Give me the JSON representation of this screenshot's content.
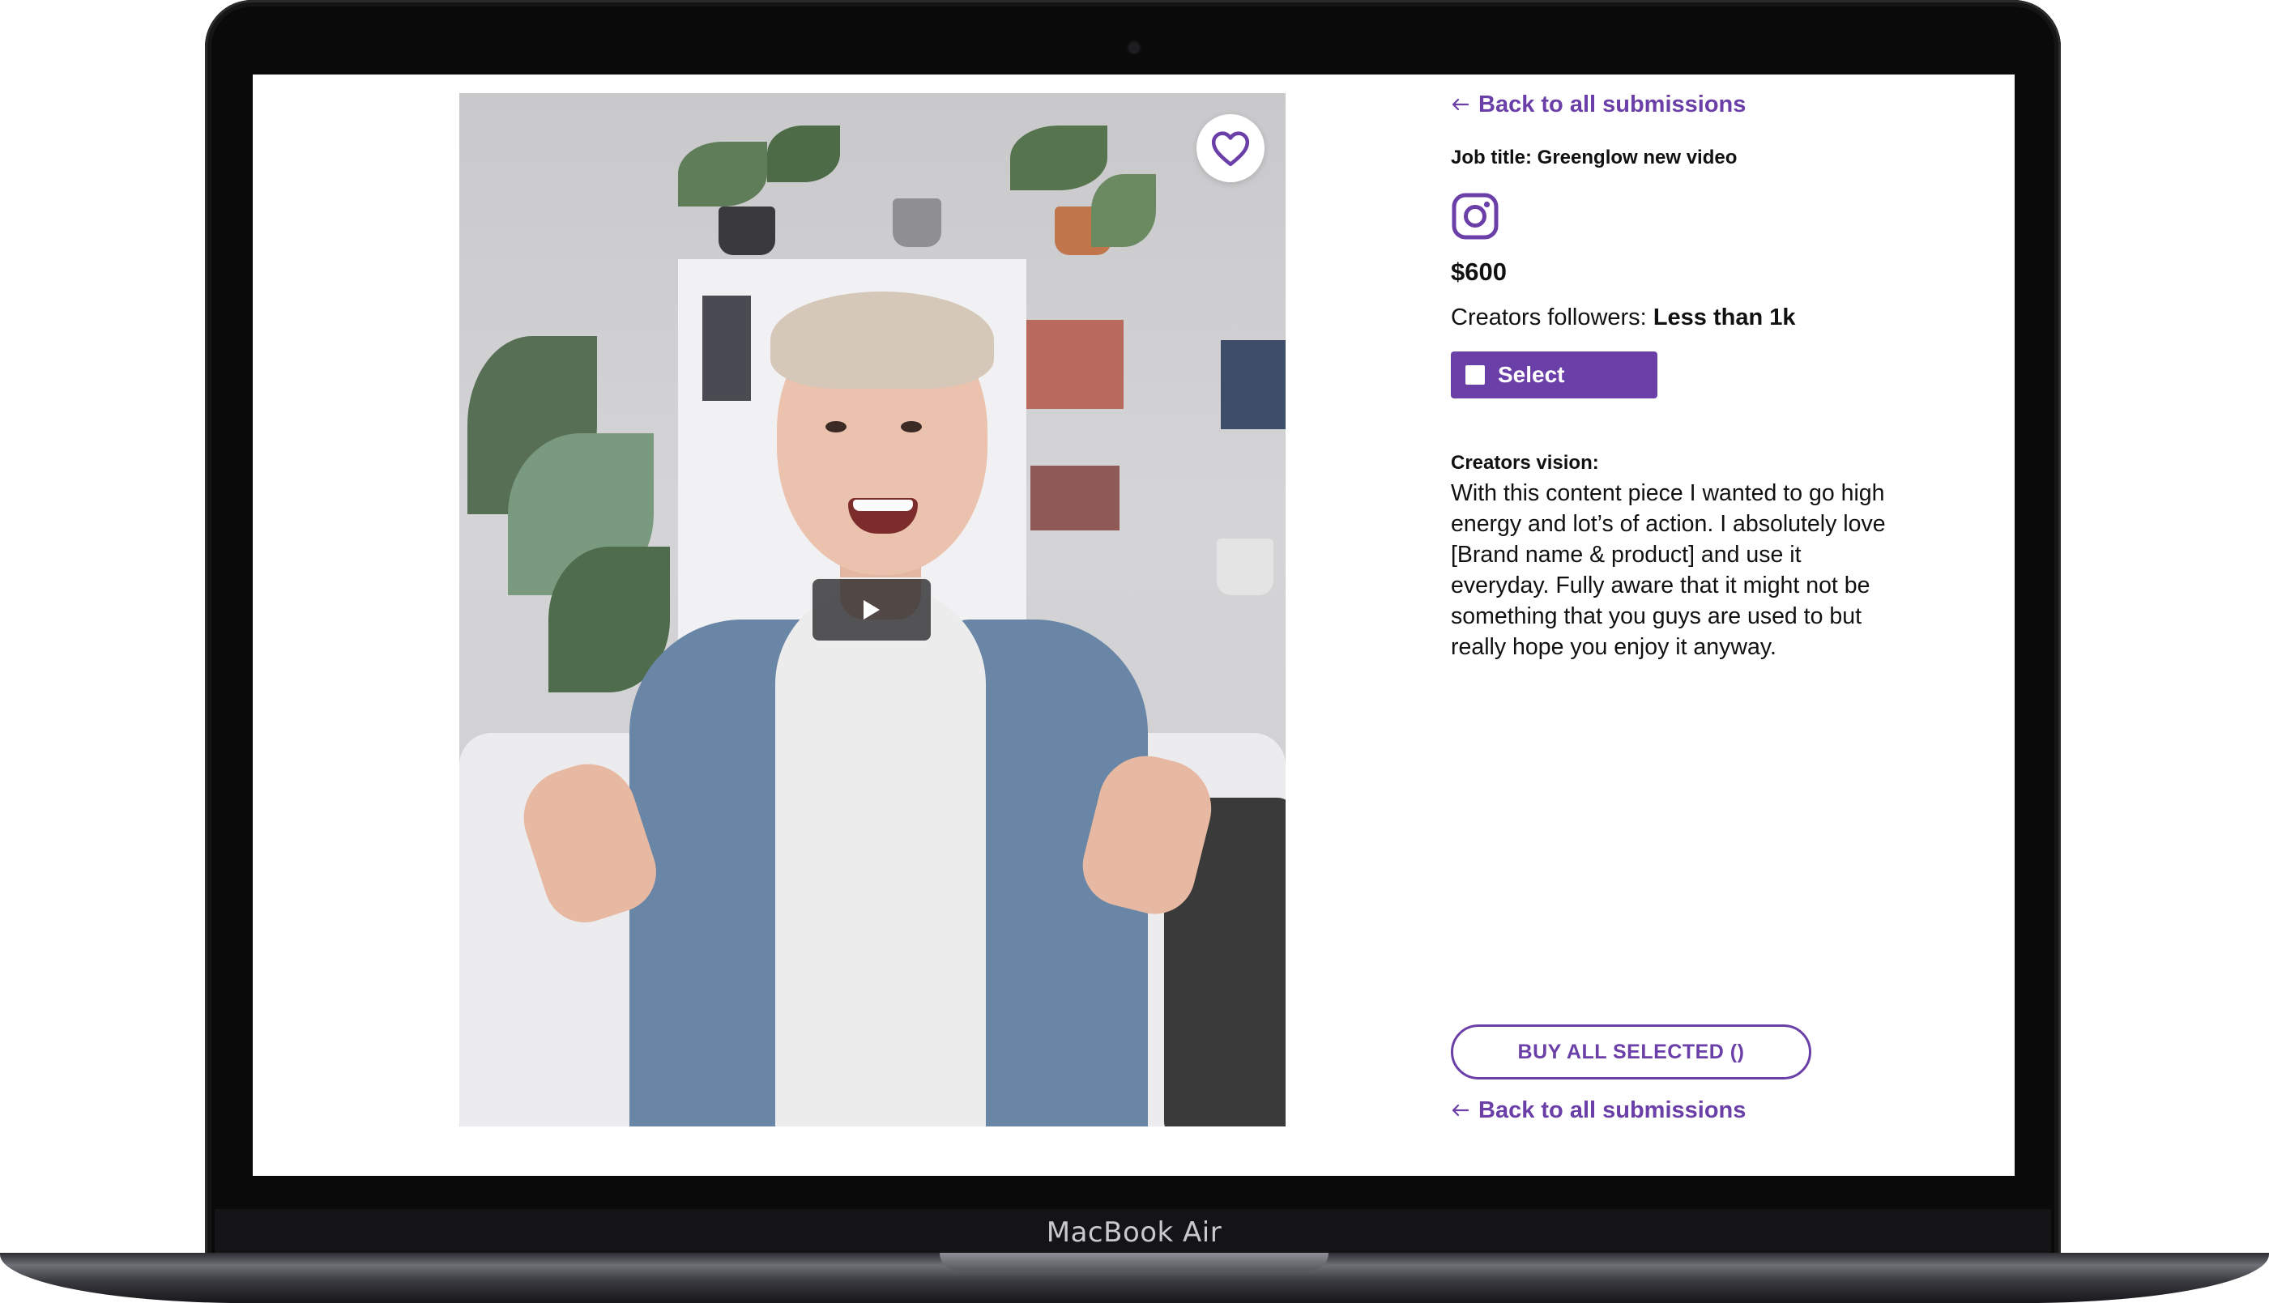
{
  "device": {
    "brand_label": "MacBook Air"
  },
  "video": {
    "favorite_icon": "heart-outline-icon",
    "play_icon": "play-icon"
  },
  "details": {
    "back_link_top": "Back to all submissions",
    "back_link_bottom": "Back to all submissions",
    "back_icon": "arrow-left-icon",
    "job_title": "Job title: Greenglow new video",
    "platform_icon": "instagram-icon",
    "price": "$600",
    "followers_label": "Creators followers: ",
    "followers_value": "Less than 1k",
    "select_label": "Select",
    "vision_label": "Creators vision:",
    "vision_text": "With this content piece I wanted to go high energy and lot’s of action. I absolutely love [Brand name & product] and use it everyday. Fully aware that it might not be something that you guys are used to but really hope you enjoy it anyway.",
    "buy_label": "BUY ALL SELECTED ()"
  },
  "colors": {
    "accent": "#6b3fa8",
    "text": "#111111"
  }
}
